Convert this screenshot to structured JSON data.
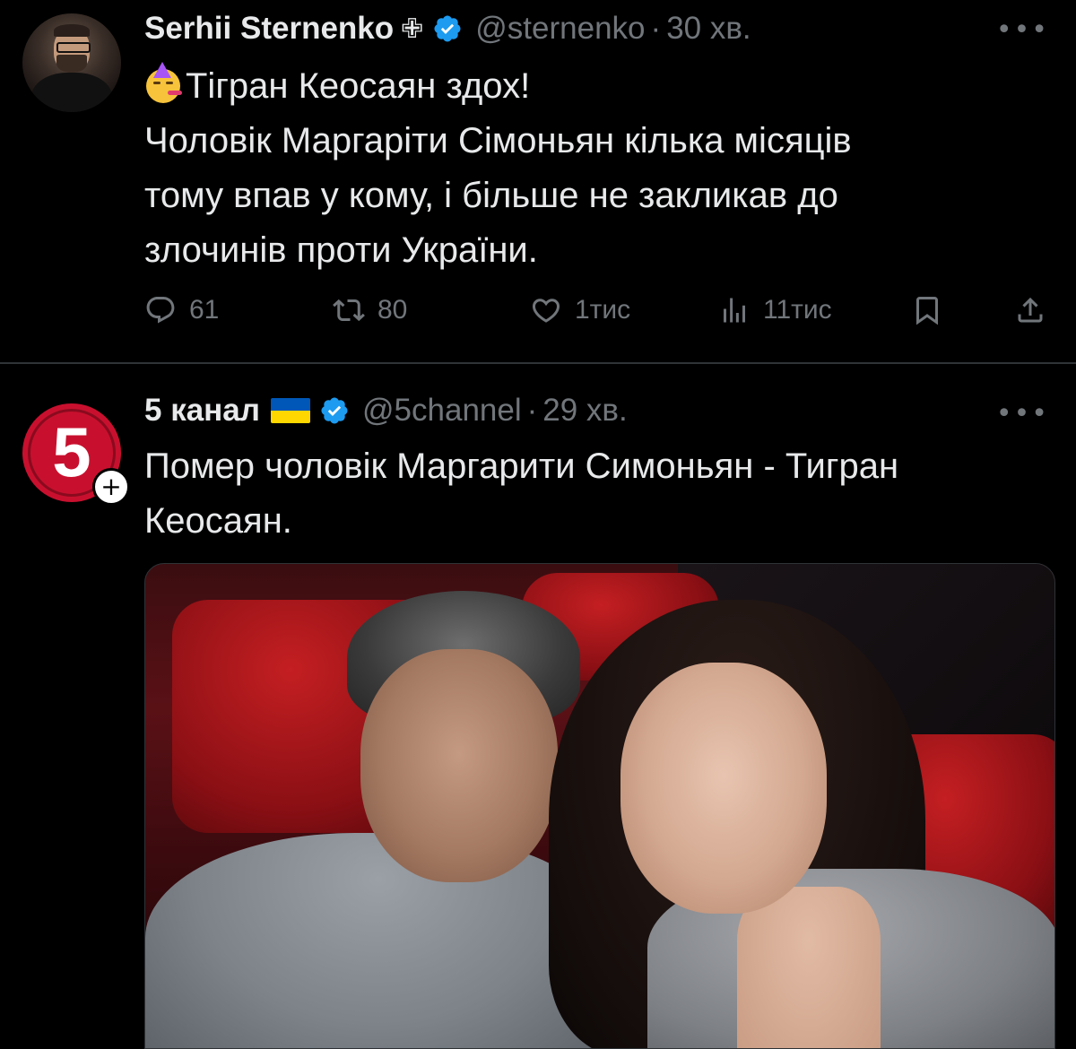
{
  "tweets": [
    {
      "author_name": "Serhii Sternenko",
      "author_badge": "✙",
      "handle": "@sternenko",
      "separator": "·",
      "time": "30 хв.",
      "emoji": "partying-face-emoji",
      "text_lines": [
        "Тігран Кеосаян здох!",
        "Чоловік Маргаріти Сімоньян кілька місяців",
        "тому впав у кому, і більше не закликав до",
        "злочинів проти України."
      ],
      "actions": {
        "replies": "61",
        "retweets": "80",
        "likes": "1тис",
        "views": "11тис"
      }
    },
    {
      "author_name": "5 канал",
      "avatar_text": "5",
      "follow_symbol": "+",
      "handle": "@5channel",
      "separator": "·",
      "time": "29 хв.",
      "flag": "ukraine-flag",
      "text_lines": [
        "Помер чоловік Маргарити Симоньян - Тигран",
        "Кеосаян."
      ],
      "media": "photo"
    }
  ],
  "more_symbol": "•••",
  "colors": {
    "background": "#000000",
    "text": "#e7e9ea",
    "secondary": "#71767b",
    "verified": "#1d9bf0",
    "divider": "#2f3336",
    "channel_red": "#c8102e"
  },
  "icons": [
    "reply-icon",
    "retweet-icon",
    "like-icon",
    "views-icon",
    "bookmark-icon",
    "share-icon",
    "verified-icon",
    "more-icon"
  ]
}
